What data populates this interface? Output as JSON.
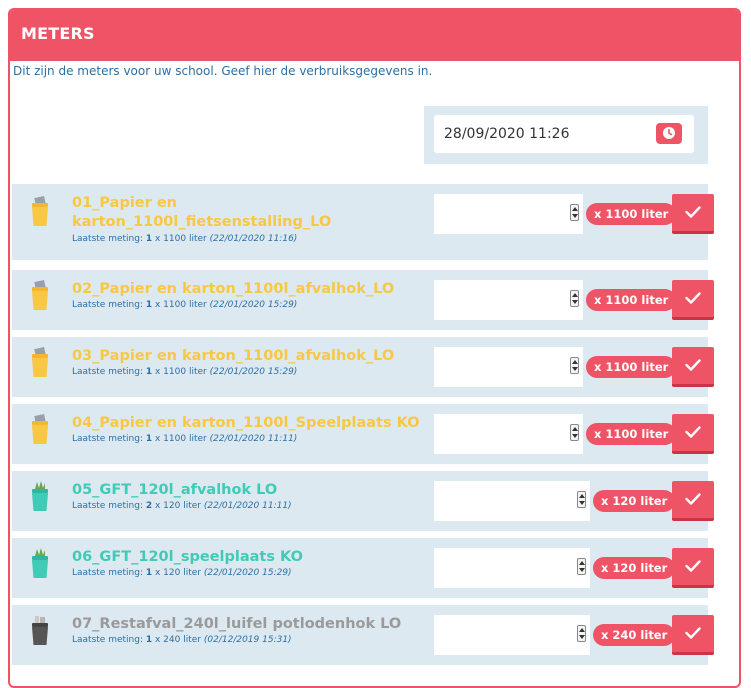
{
  "panel": {
    "title": "METERS",
    "intro": "Dit zijn de meters voor uw school. Geef hier de verbruiksgegevens in."
  },
  "datetime": {
    "value": "28/09/2020 11:26",
    "icon": "clock-icon"
  },
  "colors": {
    "accent": "#ef5366",
    "paper": "#f8c744",
    "gft": "#3fcbb5",
    "rest": "#9a9a9a",
    "row_bg": "#dde9f1"
  },
  "meters": [
    {
      "title_line1": "01_Papier en",
      "title_line2": "karton_1100l_fietsenstalling_LO",
      "last_label": "Laatste meting:",
      "last_count": "1",
      "last_unit": "x 1100 liter",
      "last_date": "(22/01/2020 11:16)",
      "unit_badge": "x 1100 liter",
      "type": "paper",
      "value": ""
    },
    {
      "title_line1": "02_Papier en karton_1100l_afvalhok_LO",
      "title_line2": "",
      "last_label": "Laatste meting:",
      "last_count": "1",
      "last_unit": "x 1100 liter",
      "last_date": "(22/01/2020 15:29)",
      "unit_badge": "x 1100 liter",
      "type": "paper",
      "value": ""
    },
    {
      "title_line1": "03_Papier en karton_1100l_afvalhok_LO",
      "title_line2": "",
      "last_label": "Laatste meting:",
      "last_count": "1",
      "last_unit": "x 1100 liter",
      "last_date": "(22/01/2020 15:29)",
      "unit_badge": "x 1100 liter",
      "type": "paper",
      "value": ""
    },
    {
      "title_line1": "04_Papier en karton_1100l_Speelplaats KO",
      "title_line2": "",
      "last_label": "Laatste meting:",
      "last_count": "1",
      "last_unit": "x 1100 liter",
      "last_date": "(22/01/2020 11:11)",
      "unit_badge": "x 1100 liter",
      "type": "paper",
      "value": ""
    },
    {
      "title_line1": "05_GFT_120l_afvalhok LO",
      "title_line2": "",
      "last_label": "Laatste meting:",
      "last_count": "2",
      "last_unit": "x 120 liter",
      "last_date": "(22/01/2020 11:11)",
      "unit_badge": "x 120 liter",
      "type": "gft",
      "value": ""
    },
    {
      "title_line1": "06_GFT_120l_speelplaats KO",
      "title_line2": "",
      "last_label": "Laatste meting:",
      "last_count": "1",
      "last_unit": "x 120 liter",
      "last_date": "(22/01/2020 15:29)",
      "unit_badge": "x 120 liter",
      "type": "gft",
      "value": ""
    },
    {
      "title_line1": "07_Restafval_240l_luifel potlodenhok LO",
      "title_line2": "",
      "last_label": "Laatste meting:",
      "last_count": "1",
      "last_unit": "x 240 liter",
      "last_date": "(02/12/2019 15:31)",
      "unit_badge": "x 240 liter",
      "type": "rest",
      "value": ""
    }
  ]
}
